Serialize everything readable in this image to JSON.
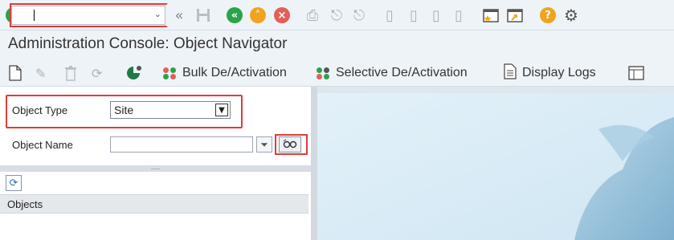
{
  "system_toolbar": {
    "command_field": {
      "value": "",
      "placeholder": ""
    },
    "icons": [
      "enter-icon",
      "back-icon",
      "save-icon",
      "back-green-icon",
      "exit-icon",
      "cancel-icon",
      "print-icon",
      "find-icon",
      "find-next-icon",
      "first-page-icon",
      "prev-page-icon",
      "next-page-icon",
      "last-page-icon",
      "new-session-icon",
      "shortcut-icon",
      "help-icon",
      "settings-icon"
    ]
  },
  "title": "Administration Console: Object Navigator",
  "app_toolbar": {
    "bulk_label": "Bulk De/Activation",
    "selective_label": "Selective De/Activation",
    "logs_label": "Display Logs"
  },
  "form": {
    "object_type_label": "Object Type",
    "object_type_value": "Site",
    "object_name_label": "Object Name",
    "object_name_value": ""
  },
  "tree": {
    "splitter_dots": ".....",
    "header": "Objects"
  },
  "colors": {
    "highlight": "#e23b3b",
    "accent_green": "#2aa34a",
    "accent_orange": "#f0a41e"
  }
}
